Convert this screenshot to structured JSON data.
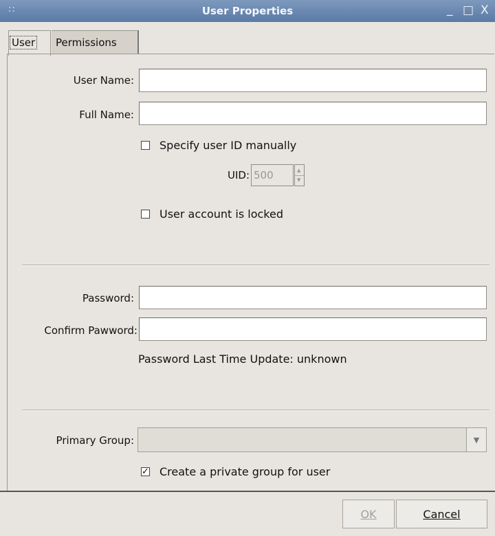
{
  "window": {
    "title": "User Properties",
    "grip_icon": "::",
    "minimize_icon": "_",
    "maximize_icon": "□",
    "close_icon": "X"
  },
  "tabs": [
    {
      "label": "User",
      "active": true
    },
    {
      "label": "Permissions",
      "active": false
    }
  ],
  "user_section": {
    "user_name_label": "User Name:",
    "user_name_value": "",
    "full_name_label": "Full Name:",
    "full_name_value": "",
    "specify_uid_label": "Specify user ID manually",
    "specify_uid_checked": false,
    "uid_label": "UID:",
    "uid_value": "500",
    "locked_label": "User account is locked",
    "locked_checked": false
  },
  "password_section": {
    "password_label": "Password:",
    "password_value": "",
    "confirm_label": "Confirm Pawword:",
    "confirm_value": "",
    "last_update_text": "Password Last Time Update: unknown"
  },
  "group_section": {
    "primary_group_label": "Primary Group:",
    "primary_group_value": "",
    "private_group_label": "Create a private group for user",
    "private_group_checked": true
  },
  "buttons": {
    "ok_label": "OK",
    "cancel_label": "Cancel"
  },
  "colors": {
    "titlebar": "#6b88b0",
    "background": "#e8e5e0"
  }
}
